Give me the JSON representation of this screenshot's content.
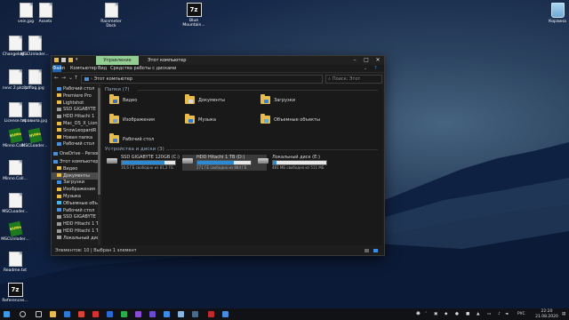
{
  "desktop": {
    "icons": [
      {
        "label": "vein.jpg",
        "icon": "image-doc-icon"
      },
      {
        "label": "Assets",
        "icon": "doc-icon"
      },
      {
        "label": "Rainmeter Dock",
        "icon": "doc-icon"
      },
      {
        "label": "Blue Mountain...",
        "icon": "7z-archive-icon"
      },
      {
        "label": "Корзина",
        "icon": "recycle-bin-icon"
      },
      {
        "label": "Changelog...",
        "icon": "doc-icon"
      },
      {
        "label": "MSCUnloder...",
        "icon": "doc-icon"
      },
      {
        "label": "nvvc 2.pkzip",
        "icon": "doc-icon"
      },
      {
        "label": "tdflag.jpg",
        "icon": "doc-icon"
      },
      {
        "label": "License.txt",
        "icon": "doc-icon"
      },
      {
        "label": "правила.jpg",
        "icon": "doc-icon"
      },
      {
        "label": "Minno.Coll...",
        "icon": "nvme-icon"
      },
      {
        "label": "MSCLoader...",
        "icon": "nvme-icon"
      },
      {
        "label": "Minno.Coll...",
        "icon": "doc-icon"
      },
      {
        "label": "MSCLoader...",
        "icon": "doc-icon"
      },
      {
        "label": "MSCUnloder...",
        "icon": "nvme-icon"
      },
      {
        "label": "Readme.txt",
        "icon": "doc-icon"
      },
      {
        "label": "References...",
        "icon": "7z-archive-icon"
      }
    ]
  },
  "window": {
    "context_tab": "Управление",
    "title": "Этот компьютер",
    "ribbon_tabs": [
      "Файл",
      "Компьютер",
      "Вид",
      "Средства работы с дисками"
    ],
    "address": "Этот компьютер",
    "search_placeholder": "Поиск: Этот компьютер",
    "nav": [
      {
        "label": "Рабочий стол",
        "color": "#4b8fd6"
      },
      {
        "label": "Premiere Pro",
        "color": "#e8bc4c"
      },
      {
        "label": "Lightshot",
        "color": "#e8bc4c"
      },
      {
        "label": "SSD GIGABYTE",
        "color": "#9a9a9a"
      },
      {
        "label": "HDD Hitachi 1",
        "color": "#9a9a9a"
      },
      {
        "label": "Mac_OS_X_Lion",
        "color": "#e8bc4c"
      },
      {
        "label": "SnowLeopardR",
        "color": "#e8bc4c"
      },
      {
        "label": "Новая папка",
        "color": "#e8bc4c"
      },
      {
        "label": "Рабочий стол",
        "color": "#4b8fd6"
      },
      {
        "label": "OneDrive - Personal",
        "color": "#4b8fd6"
      },
      {
        "label": "Этот компьютер",
        "color": "#4b8fd6"
      },
      {
        "label": "Видео",
        "color": "#e8bc4c"
      },
      {
        "label": "Документы",
        "color": "#e8bc4c"
      },
      {
        "label": "Загрузки",
        "color": "#3a8ee6"
      },
      {
        "label": "Изображения",
        "color": "#e8bc4c"
      },
      {
        "label": "Музыка",
        "color": "#e8bc4c"
      },
      {
        "label": "Объемные объекты",
        "color": "#4bb3e6"
      },
      {
        "label": "Рабочий стол",
        "color": "#4b8fd6"
      },
      {
        "label": "SSD GIGABYTE 120",
        "color": "#9a9a9a"
      },
      {
        "label": "HDD Hitachi 1 TB",
        "color": "#9a9a9a"
      },
      {
        "label": "HDD Hitachi 1 TB",
        "color": "#9a9a9a"
      },
      {
        "label": "Локальный дис",
        "color": "#9a9a9a"
      },
      {
        "label": "Сеть",
        "color": "#4b8fd6"
      }
    ],
    "folders_header": "Папки (7)",
    "folders": [
      {
        "label": "Видео",
        "badge": "#3b6fc4"
      },
      {
        "label": "Документы",
        "badge": "#d9d9d9"
      },
      {
        "label": "Загрузки",
        "badge": "#2a86e0"
      },
      {
        "label": "Изображения",
        "badge": "#6fa0d8"
      },
      {
        "label": "Музыка",
        "badge": "#2b7ad8"
      },
      {
        "label": "Объемные объекты",
        "badge": "#4bb3e6"
      },
      {
        "label": "Рабочий стол",
        "badge": "#3a7fd0"
      }
    ],
    "drives_header": "Устройства и диски (3)",
    "drives": [
      {
        "label": "SSD GIGABYTE 120GB (C:)",
        "free": "16,6 ГБ свободно из 81,2 ГБ",
        "used_fraction": 0.8
      },
      {
        "label": "HDD Hitachi 1 TB (D:)",
        "free": "271 ГБ свободно из 884 ГБ",
        "used_fraction": 0.69
      },
      {
        "label": "Локальный диск (E:)",
        "free": "481 МБ свободно из 511 МБ",
        "used_fraction": 0.06
      }
    ],
    "status": "Элементов: 10  |  Выбран 1 элемент"
  },
  "taskbar": {
    "apps": [
      {
        "name": "start-icon",
        "color": "#3a9be8"
      },
      {
        "name": "search-icon",
        "color": "#c8c8c8"
      },
      {
        "name": "task-view-icon",
        "color": "#c8c8c8"
      },
      {
        "name": "explorer-icon",
        "color": "#e8bc4c"
      },
      {
        "name": "store-icon",
        "color": "#2b7ad8"
      },
      {
        "name": "chrome-icon",
        "color": "#d94234"
      },
      {
        "name": "opera-icon",
        "color": "#d63030"
      },
      {
        "name": "photoshop-icon",
        "color": "#2a6ad6"
      },
      {
        "name": "spotify-icon",
        "color": "#27b04a"
      },
      {
        "name": "premiere-icon",
        "color": "#8a4bd6"
      },
      {
        "name": "aftereffects-icon",
        "color": "#6a4ad0"
      },
      {
        "name": "dropbox-icon",
        "color": "#3a8ee6"
      },
      {
        "name": "network-app-icon",
        "color": "#8ab4e0"
      },
      {
        "name": "steam-icon",
        "color": "#4a6a8a"
      },
      {
        "name": "filezilla-icon",
        "color": "#c02a2a"
      },
      {
        "name": "app-icon",
        "color": "#4a8ae0"
      }
    ],
    "lang": "РУС",
    "time": "22:20",
    "date": "21.08.2020"
  }
}
